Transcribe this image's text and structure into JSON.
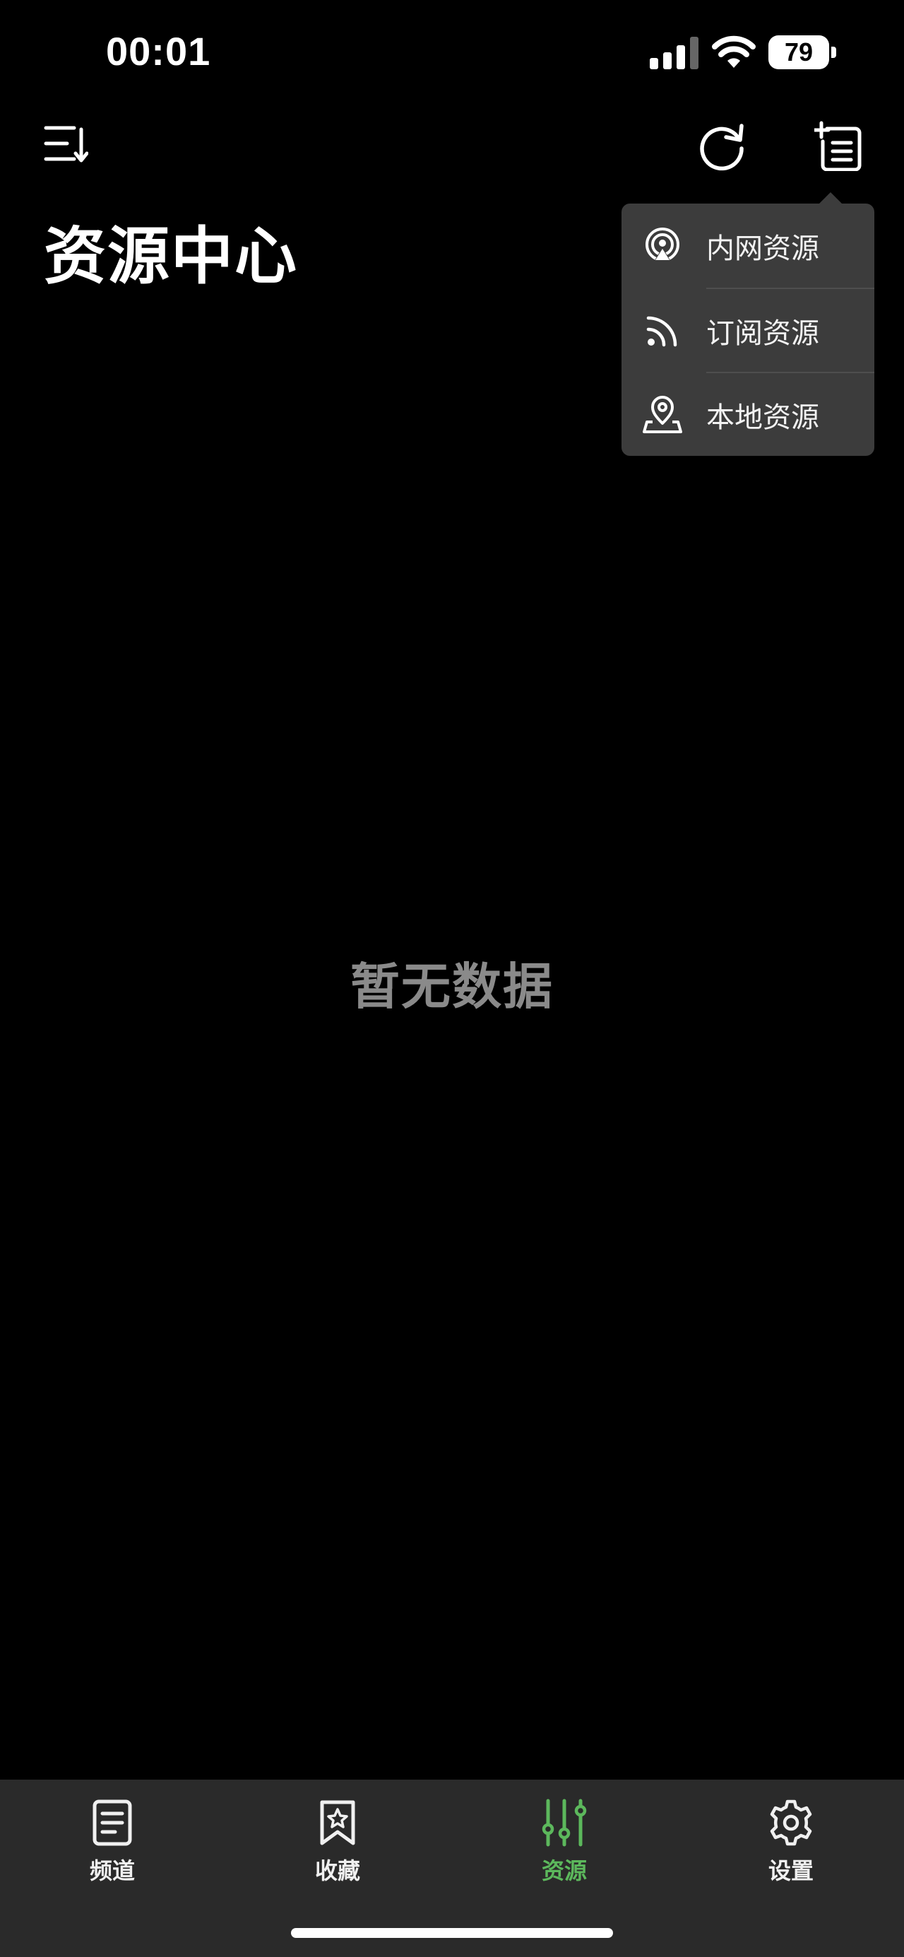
{
  "status_bar": {
    "time": "00:01",
    "battery_level": "79",
    "icons": [
      "signal-icon",
      "wifi-icon",
      "battery-icon"
    ]
  },
  "header": {
    "title": "资源中心",
    "icons": [
      "sort-icon",
      "refresh-icon",
      "add-list-icon"
    ]
  },
  "popover_menu": {
    "items": [
      {
        "label": "内网资源",
        "icon": "broadcast-icon"
      },
      {
        "label": "订阅资源",
        "icon": "rss-icon"
      },
      {
        "label": "本地资源",
        "icon": "location-pin-icon"
      }
    ]
  },
  "main": {
    "empty_text": "暂无数据"
  },
  "tab_bar": {
    "active_index": 2,
    "accent_color": "#5cb85c",
    "tabs": [
      {
        "label": "频道",
        "icon": "document-icon"
      },
      {
        "label": "收藏",
        "icon": "bookmark-star-icon"
      },
      {
        "label": "资源",
        "icon": "sliders-icon"
      },
      {
        "label": "设置",
        "icon": "gear-icon"
      }
    ]
  }
}
